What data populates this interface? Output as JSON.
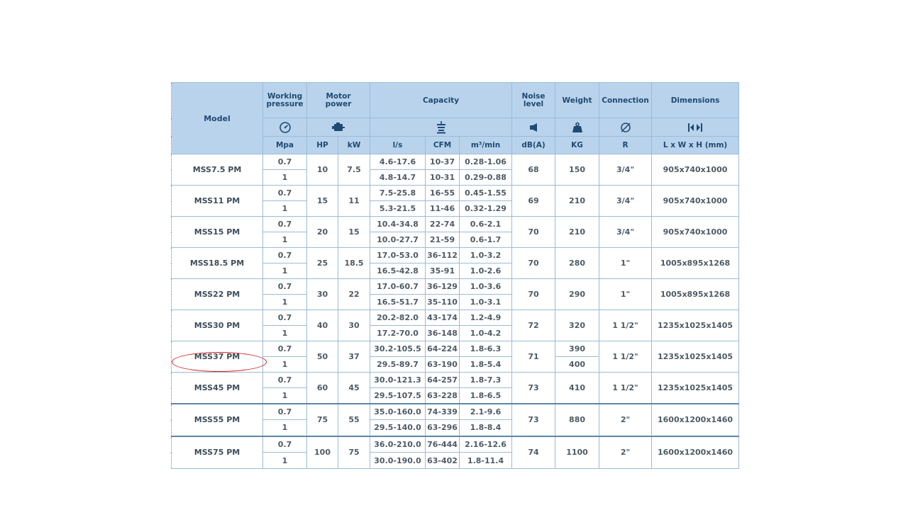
{
  "headers": {
    "model": "Model",
    "working_pressure": [
      "Working",
      "pressure"
    ],
    "motor_power": [
      "Motor",
      "power"
    ],
    "capacity": "Capacity",
    "noise_level": [
      "Noise",
      "level"
    ],
    "weight": "Weight",
    "connection": "Connection",
    "dimensions": "Dimensions"
  },
  "icons": [
    "gauge-icon",
    "motor-icon",
    "fan-capacity-icon",
    "speaker-icon",
    "weight-icon",
    "diameter-icon",
    "dimensions-arrows-icon"
  ],
  "units": {
    "pressure": "Mpa",
    "hp": "HP",
    "kw": "kW",
    "ls": "l/s",
    "cfm": "CFM",
    "m3min": "m³/min",
    "noise": "dB(A)",
    "weight": "KG",
    "connection": "R",
    "dimensions": "L x W x H (mm)"
  },
  "rows": [
    {
      "model": "MSS7.5 PM",
      "hp": "10",
      "kw": "7.5",
      "noise": "68",
      "connection": "3/4\"",
      "dimensions": "905x740x1000",
      "sub": [
        {
          "pressure": "0.7",
          "ls": "4.6-17.6",
          "cfm": "10-37",
          "m3": "0.28-1.06"
        },
        {
          "pressure": "1",
          "ls": "4.8-14.7",
          "cfm": "10-31",
          "m3": "0.29-0.88"
        }
      ],
      "weight": [
        "150"
      ]
    },
    {
      "model": "MSS11 PM",
      "hp": "15",
      "kw": "11",
      "noise": "69",
      "connection": "3/4\"",
      "dimensions": "905x740x1000",
      "sub": [
        {
          "pressure": "0.7",
          "ls": "7.5-25.8",
          "cfm": "16-55",
          "m3": "0.45-1.55"
        },
        {
          "pressure": "1",
          "ls": "5.3-21.5",
          "cfm": "11-46",
          "m3": "0.32-1.29"
        }
      ],
      "weight": [
        "210"
      ]
    },
    {
      "model": "MSS15 PM",
      "hp": "20",
      "kw": "15",
      "noise": "70",
      "connection": "3/4\"",
      "dimensions": "905x740x1000",
      "sub": [
        {
          "pressure": "0.7",
          "ls": "10.4-34.8",
          "cfm": "22-74",
          "m3": "0.6-2.1"
        },
        {
          "pressure": "1",
          "ls": "10.0-27.7",
          "cfm": "21-59",
          "m3": "0.6-1.7"
        }
      ],
      "weight": [
        "210"
      ]
    },
    {
      "model": "MSS18.5 PM",
      "hp": "25",
      "kw": "18.5",
      "noise": "70",
      "connection": "1\"",
      "dimensions": "1005x895x1268",
      "sub": [
        {
          "pressure": "0.7",
          "ls": "17.0-53.0",
          "cfm": "36-112",
          "m3": "1.0-3.2"
        },
        {
          "pressure": "1",
          "ls": "16.5-42.8",
          "cfm": "35-91",
          "m3": "1.0-2.6"
        }
      ],
      "weight": [
        "280"
      ]
    },
    {
      "model": "MSS22 PM",
      "hp": "30",
      "kw": "22",
      "noise": "70",
      "connection": "1\"",
      "dimensions": "1005x895x1268",
      "sub": [
        {
          "pressure": "0.7",
          "ls": "17.0-60.7",
          "cfm": "36-129",
          "m3": "1.0-3.6"
        },
        {
          "pressure": "1",
          "ls": "16.5-51.7",
          "cfm": "35-110",
          "m3": "1.0-3.1"
        }
      ],
      "weight": [
        "290"
      ]
    },
    {
      "model": "MSS30 PM",
      "hp": "40",
      "kw": "30",
      "noise": "72",
      "connection": "1 1/2\"",
      "dimensions": "1235x1025x1405",
      "sub": [
        {
          "pressure": "0.7",
          "ls": "20.2-82.0",
          "cfm": "43-174",
          "m3": "1.2-4.9"
        },
        {
          "pressure": "1",
          "ls": "17.2-70.0",
          "cfm": "36-148",
          "m3": "1.0-4.2"
        }
      ],
      "weight": [
        "320"
      ]
    },
    {
      "model": "MSS37 PM",
      "hp": "50",
      "kw": "37",
      "noise": "71",
      "connection": "1 1/2\"",
      "dimensions": "1235x1025x1405",
      "sub": [
        {
          "pressure": "0.7",
          "ls": "30.2-105.5",
          "cfm": "64-224",
          "m3": "1.8-6.3"
        },
        {
          "pressure": "1",
          "ls": "29.5-89.7",
          "cfm": "63-190",
          "m3": "1.8-5.4"
        }
      ],
      "weight": [
        "390",
        "400"
      ]
    },
    {
      "model": "MSS45 PM",
      "hp": "60",
      "kw": "45",
      "noise": "73",
      "connection": "1 1/2\"",
      "dimensions": "1235x1025x1405",
      "sub": [
        {
          "pressure": "0.7",
          "ls": "30.0-121.3",
          "cfm": "64-257",
          "m3": "1.8-7.3"
        },
        {
          "pressure": "1",
          "ls": "29.5-107.5",
          "cfm": "63-228",
          "m3": "1.8-6.5"
        }
      ],
      "weight": [
        "410"
      ]
    },
    {
      "model": "MSS55 PM",
      "hp": "75",
      "kw": "55",
      "noise": "73",
      "connection": "2\"",
      "dimensions": "1600x1200x1460",
      "sub": [
        {
          "pressure": "0.7",
          "ls": "35.0-160.0",
          "cfm": "74-339",
          "m3": "2.1-9.6"
        },
        {
          "pressure": "1",
          "ls": "29.5-140.0",
          "cfm": "63-296",
          "m3": "1.8-8.4"
        }
      ],
      "weight": [
        "880"
      ]
    },
    {
      "model": "MSS75 PM",
      "hp": "100",
      "kw": "75",
      "noise": "74",
      "connection": "2\"",
      "dimensions": "1600x1200x1460",
      "sub": [
        {
          "pressure": "0.7",
          "ls": "36.0-210.0",
          "cfm": "76-444",
          "m3": "2.16-12.6"
        },
        {
          "pressure": "1",
          "ls": "30.0-190.0",
          "cfm": "63-402",
          "m3": "1.8-11.4"
        }
      ],
      "weight": [
        "1100"
      ]
    }
  ],
  "highlight": {
    "model": "MSS37 PM",
    "color": "#d21c1c"
  },
  "colors": {
    "header_bg": "#b9d3ec",
    "header_text": "#1f4a72",
    "border": "#9bbbd8",
    "cell_text": "#4e5b66"
  }
}
